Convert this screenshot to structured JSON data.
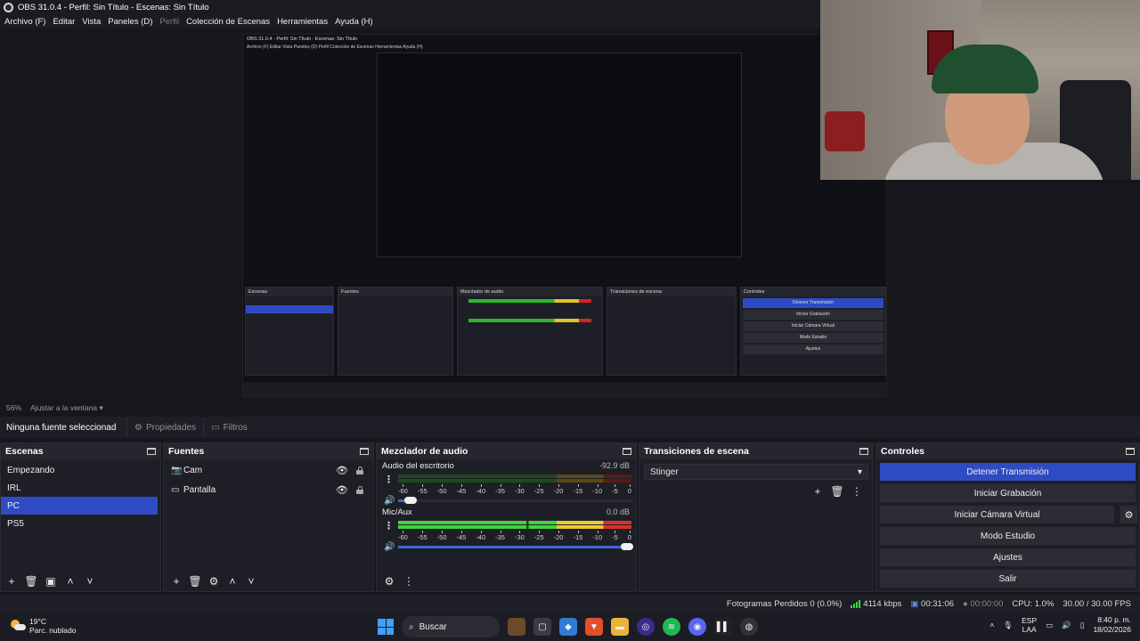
{
  "window": {
    "title": "OBS 31.0.4 - Perfil: Sin Título - Escenas: Sin Título"
  },
  "menu": [
    {
      "label": "Archivo (F)",
      "enabled": true
    },
    {
      "label": "Editar",
      "enabled": true
    },
    {
      "label": "Vista",
      "enabled": true
    },
    {
      "label": "Paneles (D)",
      "enabled": true
    },
    {
      "label": "Perfil",
      "enabled": false
    },
    {
      "label": "Colección de Escenas",
      "enabled": true
    },
    {
      "label": "Herramientas",
      "enabled": true
    },
    {
      "label": "Ayuda (H)",
      "enabled": true
    }
  ],
  "zoom": {
    "value": "56%",
    "fit_label": "Ajustar a la ventana"
  },
  "source_props": {
    "no_source": "Ninguna fuente seleccionad",
    "properties": "Propiedades",
    "filters": "Filtros"
  },
  "scenes": {
    "title": "Escenas",
    "items": [
      "Empezando",
      "IRL",
      "PC",
      "PS5"
    ],
    "selected_index": 2
  },
  "sources": {
    "title": "Fuentes",
    "items": [
      {
        "name": "Cam",
        "icon": "camera-icon"
      },
      {
        "name": "Pantalla",
        "icon": "monitor-icon"
      }
    ]
  },
  "mixer": {
    "title": "Mezclador de audio",
    "tracks": [
      {
        "name": "Audio del escritorio",
        "db": "-92.9 dB",
        "volume": 0.03,
        "live": false
      },
      {
        "name": "Mic/Aux",
        "db": "0.0 dB",
        "volume": 1.0,
        "live": true
      }
    ],
    "scale": [
      "-60",
      "-55",
      "-50",
      "-45",
      "-40",
      "-35",
      "-30",
      "-25",
      "-20",
      "-15",
      "-10",
      "-5",
      "0"
    ]
  },
  "transitions": {
    "title": "Transiciones de escena",
    "selected": "Stinger"
  },
  "controls": {
    "title": "Controles",
    "buttons": [
      "Detener Transmisión",
      "Iniciar Grabación",
      "Iniciar Cámara Virtual",
      "Modo Estudio",
      "Ajustes",
      "Salir"
    ]
  },
  "status": {
    "dropped_frames": "Fotogramas Perdidos 0 (0.0%)",
    "bitrate": "4114 kbps",
    "stream_time": "00:31:06",
    "rec_time": "00:00:00",
    "cpu": "CPU: 1.0%",
    "fps": "30.00 / 30.00 FPS"
  },
  "taskbar": {
    "temp": "19°C",
    "weather": "Parc. nublado",
    "search": "Buscar",
    "lang1": "ESP",
    "lang2": "LAA",
    "time": "8:40 p. m.",
    "date": "18/02/2026"
  },
  "colors": {
    "accent": "#2f4bc4",
    "background": "#16171d",
    "panel": "#1e1f26"
  }
}
